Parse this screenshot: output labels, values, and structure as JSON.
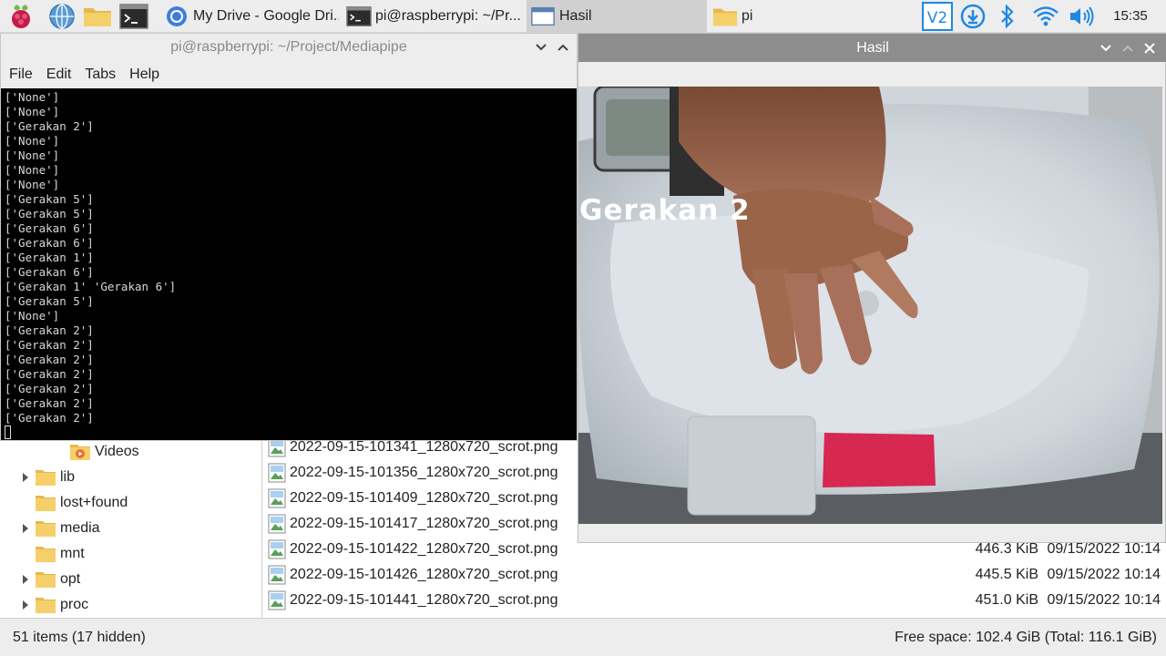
{
  "taskbar": {
    "launchers": [
      {
        "icon": "raspberry-menu-icon"
      },
      {
        "icon": "web-browser-icon"
      },
      {
        "icon": "file-manager-icon"
      },
      {
        "icon": "terminal-icon"
      }
    ],
    "tasks": [
      {
        "label": "My Drive - Google Dri...",
        "icon": "chromium-icon"
      },
      {
        "label": "pi@raspberrypi: ~/Pr...",
        "icon": "terminal-icon"
      },
      {
        "label": "Hasil",
        "icon": "window-icon"
      },
      {
        "label": "pi",
        "icon": "folder-icon"
      }
    ],
    "tray": [
      "vnc-icon",
      "download-icon",
      "bluetooth-icon",
      "wifi-icon",
      "volume-icon"
    ],
    "clock": "15:35"
  },
  "terminal": {
    "title": "pi@raspberrypi: ~/Project/Mediapipe",
    "menu": [
      "File",
      "Edit",
      "Tabs",
      "Help"
    ],
    "lines": [
      "['None']",
      "['None']",
      "['Gerakan 2']",
      "['None']",
      "['None']",
      "['None']",
      "['None']",
      "['Gerakan 5']",
      "['Gerakan 5']",
      "['Gerakan 6']",
      "['Gerakan 6']",
      "['Gerakan 1']",
      "['Gerakan 6']",
      "['Gerakan 1' 'Gerakan 6']",
      "['Gerakan 5']",
      "['None']",
      "['Gerakan 2']",
      "['Gerakan 2']",
      "['Gerakan 2']",
      "['Gerakan 2']",
      "['Gerakan 2']",
      "['Gerakan 2']",
      "['Gerakan 2']"
    ]
  },
  "hasil": {
    "title": "Hasil",
    "overlay_label": "Gerakan 2"
  },
  "file_manager": {
    "tree": [
      {
        "label": "Videos",
        "expandable": false,
        "icon": "videos-folder-icon"
      },
      {
        "label": "lib",
        "expandable": true,
        "icon": "folder-icon"
      },
      {
        "label": "lost+found",
        "expandable": false,
        "icon": "folder-icon"
      },
      {
        "label": "media",
        "expandable": true,
        "icon": "folder-icon"
      },
      {
        "label": "mnt",
        "expandable": false,
        "icon": "folder-icon"
      },
      {
        "label": "opt",
        "expandable": true,
        "icon": "folder-icon"
      },
      {
        "label": "proc",
        "expandable": true,
        "icon": "folder-icon"
      }
    ],
    "files": [
      {
        "name": "2022-09-15-101341_1280x720_scrot.png",
        "size": "",
        "date": ""
      },
      {
        "name": "2022-09-15-101356_1280x720_scrot.png",
        "size": "",
        "date": ""
      },
      {
        "name": "2022-09-15-101409_1280x720_scrot.png",
        "size": "",
        "date": ""
      },
      {
        "name": "2022-09-15-101417_1280x720_scrot.png",
        "size": "",
        "date": ""
      },
      {
        "name": "2022-09-15-101422_1280x720_scrot.png",
        "size": "446.3 KiB",
        "date": "09/15/2022 10:14"
      },
      {
        "name": "2022-09-15-101426_1280x720_scrot.png",
        "size": "445.5 KiB",
        "date": "09/15/2022 10:14"
      },
      {
        "name": "2022-09-15-101441_1280x720_scrot.png",
        "size": "451.0 KiB",
        "date": "09/15/2022 10:14"
      }
    ],
    "status_left": "51 items (17 hidden)",
    "status_right": "Free space: 102.4 GiB (Total: 116.1 GiB)"
  },
  "colors": {
    "taskbar_bg": "#ededed",
    "terminal_bg": "#000000",
    "terminal_fg": "#d8d8d8",
    "folder": "#f2c75c",
    "tray_accent": "#1e88e5",
    "hasil_title_bg": "#8d8d8d"
  }
}
